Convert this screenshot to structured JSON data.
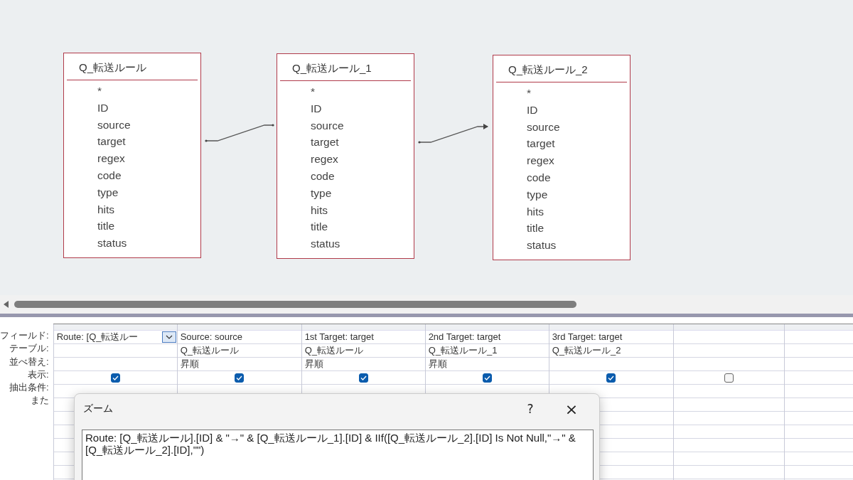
{
  "tables": [
    {
      "title": "Q_転送ルール",
      "fields": [
        "*",
        "ID",
        "source",
        "target",
        "regex",
        "code",
        "type",
        "hits",
        "title",
        "status"
      ]
    },
    {
      "title": "Q_転送ルール_1",
      "fields": [
        "*",
        "ID",
        "source",
        "target",
        "regex",
        "code",
        "type",
        "hits",
        "title",
        "status"
      ]
    },
    {
      "title": "Q_転送ルール_2",
      "fields": [
        "*",
        "ID",
        "source",
        "target",
        "regex",
        "code",
        "type",
        "hits",
        "title",
        "status"
      ]
    }
  ],
  "joins": [
    {
      "arrow": false
    },
    {
      "arrow": true
    }
  ],
  "grid": {
    "row_labels": [
      "フィールド:",
      "テーブル:",
      "並べ替え:",
      "表示:",
      "抽出条件:",
      "また"
    ],
    "columns": [
      {
        "field": "Route: [Q_転送ルー",
        "dropdown": true,
        "show": true
      },
      {
        "field": "Source: source",
        "table": "Q_転送ルール",
        "sort": "昇順",
        "show": true
      },
      {
        "field": "1st Target: target",
        "table": "Q_転送ルール",
        "sort": "昇順",
        "show": true
      },
      {
        "field": "2nd Target: target",
        "table": "Q_転送ルール_1",
        "sort": "昇順",
        "show": true
      },
      {
        "field": "3rd Target: target",
        "table": "Q_転送ルール_2",
        "show": true
      },
      {
        "show": false
      }
    ]
  },
  "dialog": {
    "title": "ズーム",
    "help": "?",
    "close": "×",
    "value": "Route: [Q_転送ルール].[ID] & \"→\" & [Q_転送ルール_1].[ID] & IIf([Q_転送ルール_2].[ID] Is Not Null,\"→\" & [Q_転送ルール_2].[ID],\"\")"
  }
}
